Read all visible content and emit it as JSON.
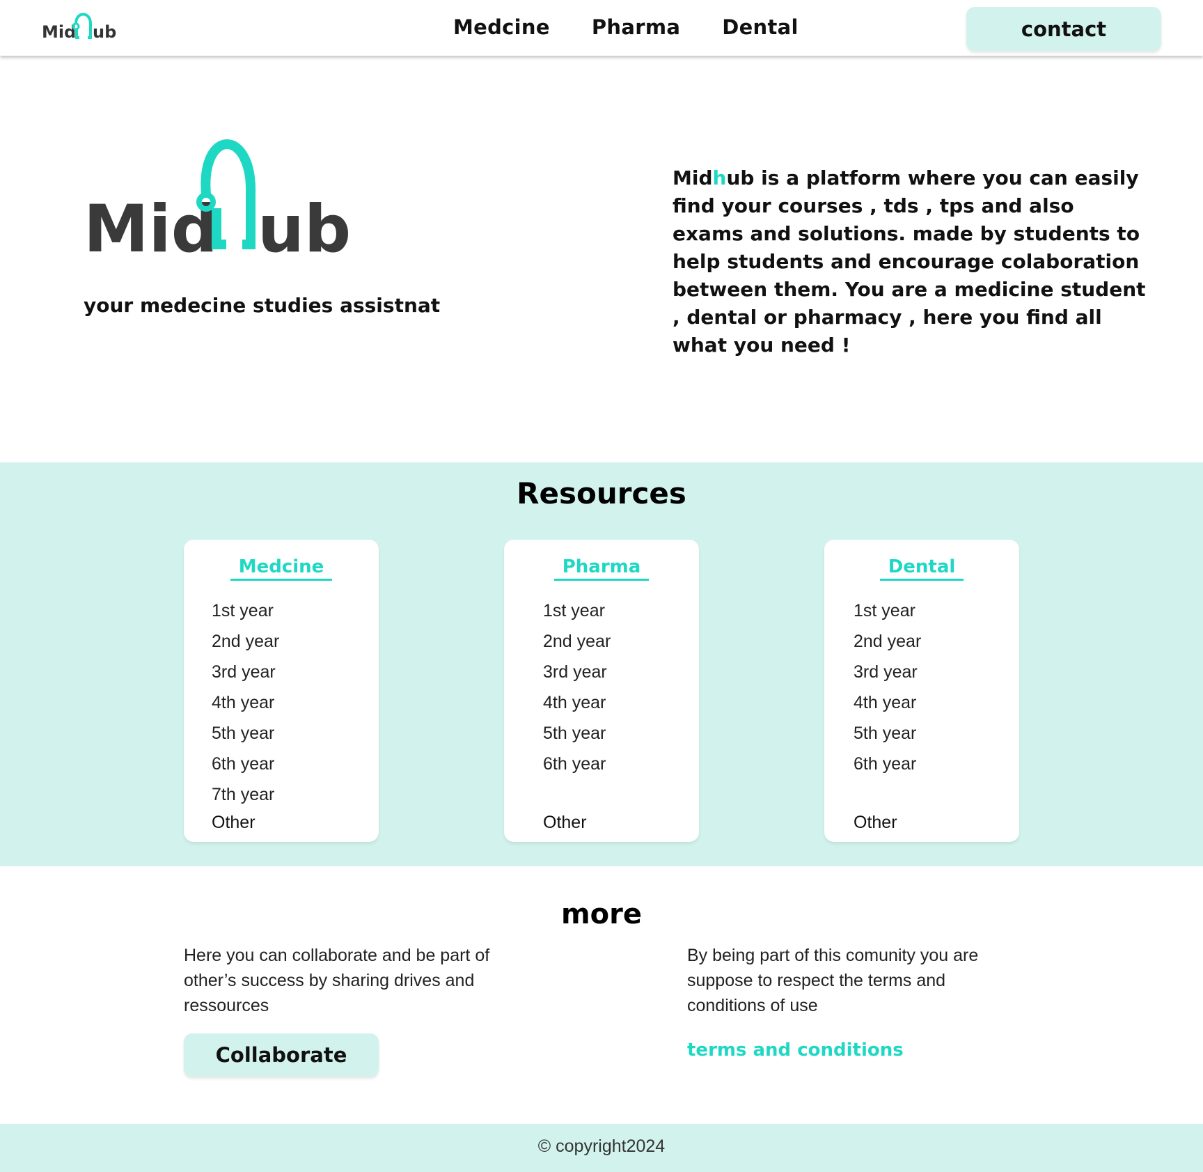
{
  "colors": {
    "accent": "#1fd8c4",
    "pale_mint": "#d2f3ed",
    "logo_dark": "#3a3a3a"
  },
  "header": {
    "logo_text": "MidHub",
    "nav": [
      {
        "label": "Medcine"
      },
      {
        "label": "Pharma"
      },
      {
        "label": "Dental"
      }
    ],
    "contact_label": "contact"
  },
  "hero": {
    "logo_text": "MidHub",
    "tagline": "your medecine studies assistnat",
    "intro_prefix": "Mid",
    "intro_accent": "h",
    "intro_rest": "ub is a platform where you can easily find your courses , tds , tps and also exams and solutions. made by students to help students and encourage colaboration between them. You are a medicine student , dental or pharmacy , here you find all what you need !"
  },
  "resources": {
    "title": "Resources",
    "cards": [
      {
        "title": "Medcine",
        "years": [
          "1st year",
          "2nd year",
          "3rd year",
          "4th year",
          "5th year",
          "6th year",
          "7th year"
        ],
        "other": "Other"
      },
      {
        "title": "Pharma",
        "years": [
          "1st year",
          "2nd year",
          "3rd year",
          "4th year",
          "5th year",
          "6th year"
        ],
        "other": "Other"
      },
      {
        "title": "Dental",
        "years": [
          "1st year",
          "2nd year",
          "3rd year",
          "4th year",
          "5th year",
          "6th year"
        ],
        "other": "Other"
      }
    ]
  },
  "more": {
    "title": "more",
    "left_text": "Here you can collaborate and be part of other’s success by sharing drives and ressources",
    "collaborate_label": "Collaborate",
    "right_text": "By being part of this comunity you are suppose to respect the terms and conditions of use",
    "terms_label": "terms and conditions"
  },
  "footer": {
    "copyright": "© copyright2024"
  }
}
